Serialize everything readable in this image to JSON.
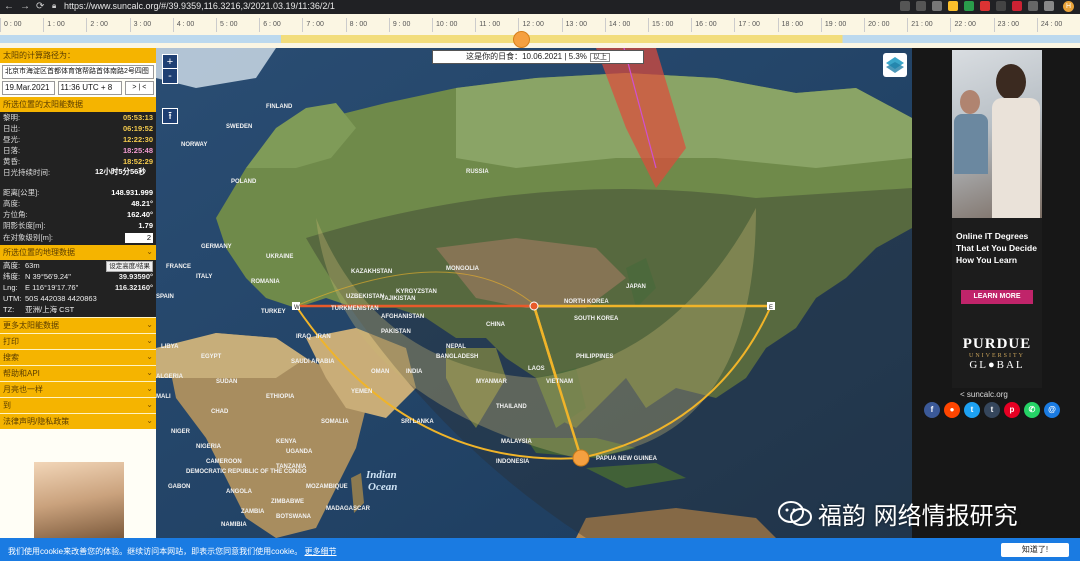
{
  "browser": {
    "url": "https://www.suncalc.org/#/39.9359,116.3216,3/2021.03.19/11:36/2/1",
    "nav_back": "←",
    "nav_forward": "→",
    "nav_reload": "⟳",
    "profile_initial": "H"
  },
  "timeline": {
    "hours": [
      "0 : 00",
      "1 : 00",
      "2 : 00",
      "3 : 00",
      "4 : 00",
      "5 : 00",
      "6 : 00",
      "7 : 00",
      "8 : 00",
      "9 : 00",
      "10 : 00",
      "11 : 00",
      "12 : 00",
      "13 : 00",
      "14 : 00",
      "15 : 00",
      "16 : 00",
      "17 : 00",
      "18 : 00",
      "19 : 00",
      "20 : 00",
      "21 : 00",
      "22 : 00",
      "23 : 00",
      "24 : 00"
    ]
  },
  "left_panel": {
    "path_header": "太阳的计算路径为：",
    "location_value": "北京市海淀区首都体育馆帮路首体南路2号四图",
    "date_value": "19.Mar.2021",
    "time_value": "11:36 UTC + 8",
    "nav_buttons": "> | <",
    "sun_header": "所选位置的太阳能数据",
    "sun_rows": [
      {
        "k": "黎明:",
        "v": "05:53:13",
        "color": "#f2c94c"
      },
      {
        "k": "日出:",
        "v": "06:19:52",
        "color": "#f2c94c"
      },
      {
        "k": "昼光:",
        "v": "12:22:30",
        "color": "#f2c94c"
      },
      {
        "k": "日落:",
        "v": "18:25:48",
        "color": "#f09ad0"
      },
      {
        "k": "黄昏:",
        "v": "18:52:29",
        "color": "#f2c94c"
      },
      {
        "k": "日光持续时间:",
        "v": "12小时5分56秒",
        "color": "#ffffff"
      },
      {
        "k": "距离[公里]:",
        "v": "148.931.999",
        "color": "#ffffff"
      },
      {
        "k": "高度:",
        "v": "48.21°",
        "color": "#ffffff"
      },
      {
        "k": "方位角:",
        "v": "162.40°",
        "color": "#ffffff"
      },
      {
        "k": "阴影长度[m]:",
        "v": "1.79",
        "color": "#ffffff"
      }
    ],
    "object_level_label": "在对象级别[m]:",
    "object_level_value": "2",
    "geo_header": "所选位置的地理数据",
    "geo_rows": [
      {
        "k": "高度:",
        "v": "63m"
      },
      {
        "k": "纬度:",
        "v": "N 39°56'9.24\"",
        "v2": "39.93590°"
      },
      {
        "k": "Lng:",
        "v": "E 116°19'17.76\"",
        "v2": "116.32160°"
      },
      {
        "k": "UTM:",
        "v": "50S 442038 4420863",
        "v2": ""
      },
      {
        "k": "TZ:",
        "v": "亚洲/上海 CST",
        "v2": ""
      }
    ],
    "set_height_button": "设定高度/结果",
    "menu_items": [
      "更多太阳能数据",
      "打印",
      "搜索",
      "帮助和API",
      "月亮也一样",
      "到",
      "法律声明/隐私政策"
    ]
  },
  "map": {
    "zoom_in": "+",
    "zoom_out": "-",
    "upload_icon": "⭱",
    "illumination_text": "这是你的日食：10.06.2021 | 5.3%",
    "illumination_button": "以上",
    "labels": [
      {
        "t": "RUSSIA"
      },
      {
        "t": "POLAND"
      },
      {
        "t": "FINLAND"
      },
      {
        "t": "SWEDEN"
      },
      {
        "t": "NORWAY"
      },
      {
        "t": "KAZAKHSTAN"
      },
      {
        "t": "MONGOLIA"
      },
      {
        "t": "CHINA"
      },
      {
        "t": "INDIA"
      },
      {
        "t": "IRAN"
      },
      {
        "t": "TURKEY"
      },
      {
        "t": "EGYPT"
      },
      {
        "t": "LIBYA"
      },
      {
        "t": "ALGERIA"
      },
      {
        "t": "SUDAN"
      },
      {
        "t": "ETHIOPIA"
      },
      {
        "t": "SAUDI ARABIA"
      },
      {
        "t": "AFGHANISTAN"
      },
      {
        "t": "UZBEKISTAN"
      },
      {
        "t": "PAKISTAN"
      },
      {
        "t": "MYANMAR"
      },
      {
        "t": "THAILAND"
      },
      {
        "t": "MALAYSIA"
      },
      {
        "t": "INDONESIA"
      },
      {
        "t": "PAPUA NEW GUINEA"
      },
      {
        "t": "SRI LANKA"
      },
      {
        "t": "MALI"
      },
      {
        "t": "NIGER"
      },
      {
        "t": "CHAD"
      },
      {
        "t": "NIGERIA"
      },
      {
        "t": "KENYA"
      },
      {
        "t": "TANZANIA"
      },
      {
        "t": "ANGOLA"
      },
      {
        "t": "ZAMBIA"
      },
      {
        "t": "MADAGASCAR"
      },
      {
        "t": "BOTSWANA"
      },
      {
        "t": "DEMOCRATIC REPUBLIC OF THE CONGO"
      },
      {
        "t": "GABON"
      },
      {
        "t": "SOMALIA"
      },
      {
        "t": "JAPAN"
      },
      {
        "t": "SOUTH KOREA"
      },
      {
        "t": "NORTH KOREA"
      },
      {
        "t": "BANGLADESH"
      },
      {
        "t": "PHILIPPINES"
      },
      {
        "t": "VIETNAM"
      },
      {
        "t": "LAOS"
      },
      {
        "t": "ITALY"
      },
      {
        "t": "GERMANY"
      },
      {
        "t": "UKRAINE"
      },
      {
        "t": "ROMANIA"
      },
      {
        "t": "SPAIN"
      },
      {
        "t": "FRANCE"
      },
      {
        "t": "IRAQ"
      },
      {
        "t": "YEMEN"
      },
      {
        "t": "OMAN"
      },
      {
        "t": "TURKMENISTAN"
      },
      {
        "t": "KYRGYZSTAN"
      },
      {
        "t": "TAJIKISTAN"
      },
      {
        "t": "NEPAL"
      },
      {
        "t": "CAMEROON"
      },
      {
        "t": "UGANDA"
      },
      {
        "t": "MOZAMBIQUE"
      },
      {
        "t": "NAMIBIA"
      },
      {
        "t": "ZIMBABWE"
      }
    ],
    "ocean_label_1": "Indian",
    "ocean_label_2": "Ocean",
    "marker_w": "W",
    "marker_e": "E"
  },
  "ad": {
    "headline_1": "Online IT Degrees",
    "headline_2": "That Let You Decide",
    "headline_3": "How You Learn",
    "cta": "LEARN MORE",
    "brand_1": "PURDUE",
    "brand_2": "UNIVERSITY",
    "brand_3": "GL●BAL",
    "share_text": "suncalc.org"
  },
  "socials": [
    {
      "name": "facebook",
      "glyph": "f",
      "color": "#3b5998"
    },
    {
      "name": "reddit",
      "glyph": "●",
      "color": "#ff4500"
    },
    {
      "name": "twitter",
      "glyph": "t",
      "color": "#1da1f2"
    },
    {
      "name": "tumblr",
      "glyph": "t",
      "color": "#35465c"
    },
    {
      "name": "pinterest",
      "glyph": "p",
      "color": "#e60023"
    },
    {
      "name": "whatsapp",
      "glyph": "✆",
      "color": "#25d366"
    },
    {
      "name": "email",
      "glyph": "@",
      "color": "#1a7be2"
    }
  ],
  "watermark": {
    "text": "福韵 网络情报研究"
  },
  "cookie": {
    "text": "我们使用cookie来改善您的体验。继续访问本网站，即表示您同意我们使用cookie。",
    "more_link": "更多细节",
    "accept": "知道了!"
  },
  "colors": {
    "accent": "#f5b400",
    "timeline_day": "#f2dd7c",
    "timeline_night": "#bcd9ee",
    "knob": "#f5a040",
    "sun_line": "#f0b429",
    "sunrise_line": "#f2a23a",
    "current_line": "#e85a2a",
    "cookie_bar": "#1a7be2"
  }
}
